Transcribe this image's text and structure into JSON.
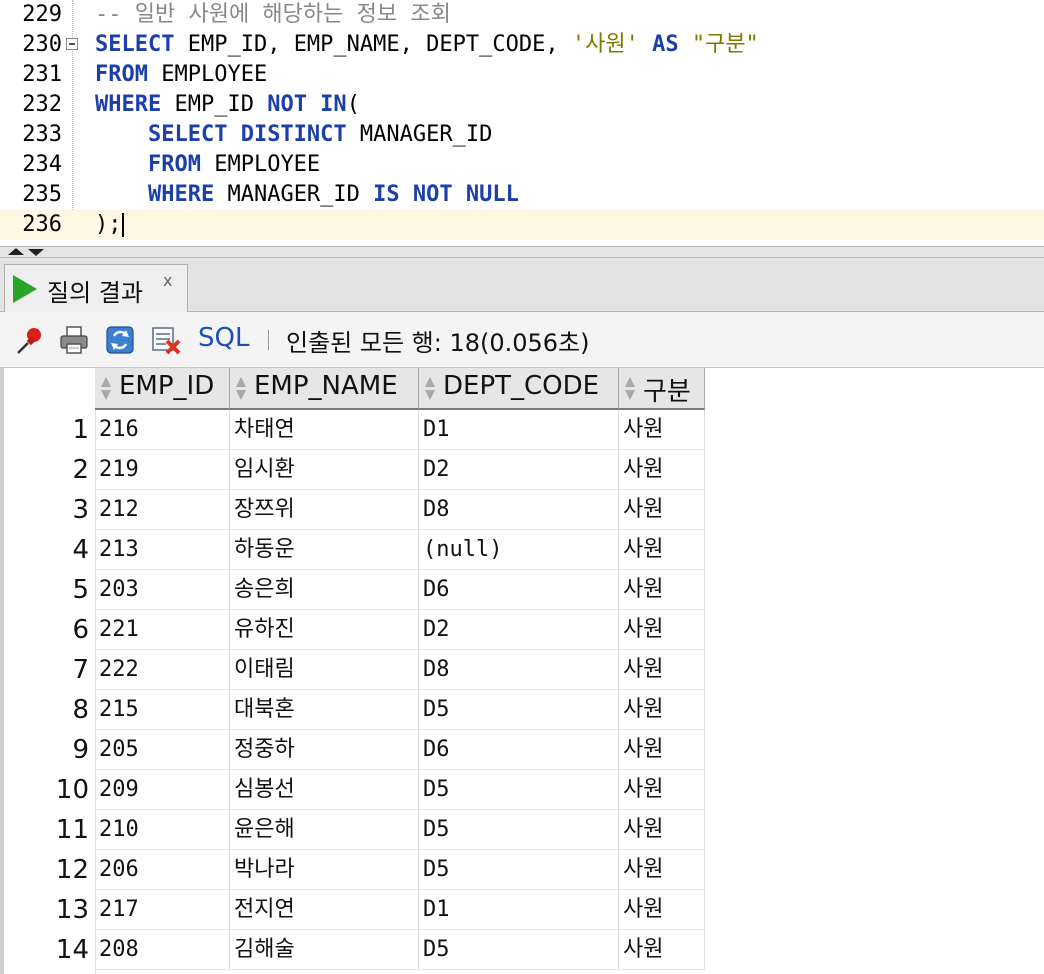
{
  "editor": {
    "lines": [
      {
        "num": "229",
        "segments": [
          {
            "t": "-- 일반 사원에 해당하는 정보 조회",
            "c": "cmt"
          }
        ]
      },
      {
        "num": "230",
        "segments": [
          {
            "t": "SELECT",
            "c": "kw"
          },
          {
            "t": " EMP_ID, EMP_NAME, DEPT_CODE, ",
            "c": ""
          },
          {
            "t": "'사원'",
            "c": "str"
          },
          {
            "t": " ",
            "c": ""
          },
          {
            "t": "AS",
            "c": "kw"
          },
          {
            "t": " ",
            "c": ""
          },
          {
            "t": "\"구분\"",
            "c": "str"
          }
        ]
      },
      {
        "num": "231",
        "segments": [
          {
            "t": "FROM",
            "c": "kw"
          },
          {
            "t": " EMPLOYEE",
            "c": ""
          }
        ]
      },
      {
        "num": "232",
        "segments": [
          {
            "t": "WHERE",
            "c": "kw"
          },
          {
            "t": " EMP_ID ",
            "c": ""
          },
          {
            "t": "NOT IN",
            "c": "kw"
          },
          {
            "t": "(",
            "c": ""
          }
        ]
      },
      {
        "num": "233",
        "segments": [
          {
            "t": "    ",
            "c": ""
          },
          {
            "t": "SELECT DISTINCT",
            "c": "kw"
          },
          {
            "t": " MANAGER_ID",
            "c": ""
          }
        ]
      },
      {
        "num": "234",
        "segments": [
          {
            "t": "    ",
            "c": ""
          },
          {
            "t": "FROM",
            "c": "kw"
          },
          {
            "t": " EMPLOYEE",
            "c": ""
          }
        ]
      },
      {
        "num": "235",
        "segments": [
          {
            "t": "    ",
            "c": ""
          },
          {
            "t": "WHERE",
            "c": "kw"
          },
          {
            "t": " MANAGER_ID ",
            "c": ""
          },
          {
            "t": "IS NOT NULL",
            "c": "kw"
          }
        ]
      },
      {
        "num": "236",
        "segments": [
          {
            "t": ");",
            "c": ""
          }
        ],
        "current": true
      }
    ]
  },
  "results": {
    "tab_label": "질의 결과",
    "tab_close": "x",
    "toolbar": {
      "sql_label": "SQL",
      "status": "인출된 모든 행: 18(0.056초)"
    },
    "columns": [
      "EMP_ID",
      "EMP_NAME",
      "DEPT_CODE",
      "구분"
    ],
    "rows": [
      {
        "n": "1",
        "cells": [
          "216",
          "차태연",
          "D1",
          "사원"
        ]
      },
      {
        "n": "2",
        "cells": [
          "219",
          "임시환",
          "D2",
          "사원"
        ]
      },
      {
        "n": "3",
        "cells": [
          "212",
          "장쯔위",
          "D8",
          "사원"
        ]
      },
      {
        "n": "4",
        "cells": [
          "213",
          "하동운",
          "(null)",
          "사원"
        ]
      },
      {
        "n": "5",
        "cells": [
          "203",
          "송은희",
          "D6",
          "사원"
        ]
      },
      {
        "n": "6",
        "cells": [
          "221",
          "유하진",
          "D2",
          "사원"
        ]
      },
      {
        "n": "7",
        "cells": [
          "222",
          "이태림",
          "D8",
          "사원"
        ]
      },
      {
        "n": "8",
        "cells": [
          "215",
          "대북혼",
          "D5",
          "사원"
        ]
      },
      {
        "n": "9",
        "cells": [
          "205",
          "정중하",
          "D6",
          "사원"
        ]
      },
      {
        "n": "10",
        "cells": [
          "209",
          "심봉선",
          "D5",
          "사원"
        ]
      },
      {
        "n": "11",
        "cells": [
          "210",
          "윤은해",
          "D5",
          "사원"
        ]
      },
      {
        "n": "12",
        "cells": [
          "206",
          "박나라",
          "D5",
          "사원"
        ]
      },
      {
        "n": "13",
        "cells": [
          "217",
          "전지연",
          "D1",
          "사원"
        ]
      },
      {
        "n": "14",
        "cells": [
          "208",
          "김해술",
          "D5",
          "사원"
        ]
      }
    ]
  },
  "colors": {
    "keyword": "#1d3fa8",
    "string": "#7a7a00",
    "comment": "#888888",
    "run_icon": "#2aa52a",
    "sql_link": "#1d4fb0"
  },
  "icons": {
    "pin": "pin-icon",
    "print": "print-icon",
    "refresh": "refresh-icon",
    "export": "export-icon",
    "run": "run-icon"
  }
}
